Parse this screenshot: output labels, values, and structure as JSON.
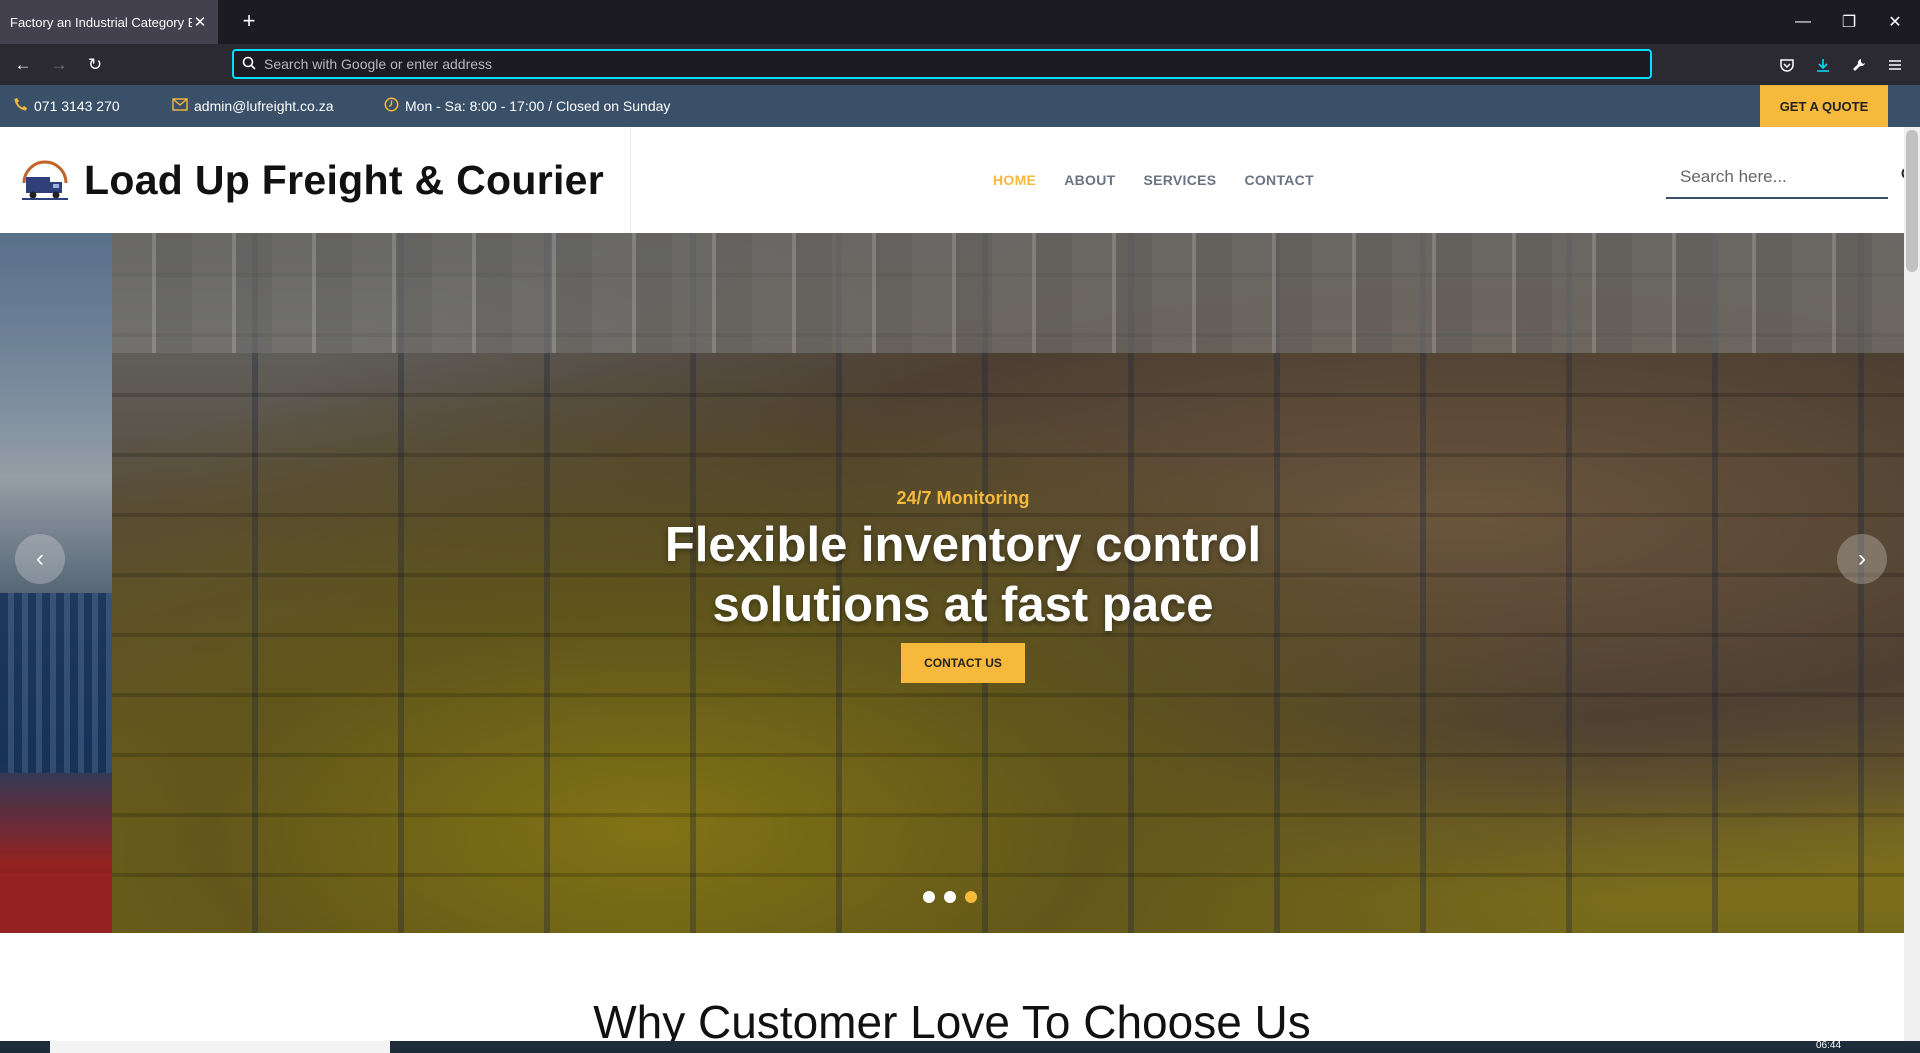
{
  "browser": {
    "tab_title": "Factory an Industrial Category Bootst",
    "url_placeholder": "Search with Google or enter address"
  },
  "topbar": {
    "phone": "071 3143 270",
    "email": "admin@lufreight.co.za",
    "hours": "Mon - Sa: 8:00 - 17:00 / Closed on Sunday",
    "quote_label": "GET A QUOTE"
  },
  "header": {
    "brand_name": "Load Up Freight & Courier",
    "menu": [
      "HOME",
      "ABOUT",
      "SERVICES",
      "CONTACT"
    ],
    "search_placeholder": "Search here..."
  },
  "hero": {
    "kicker": "24/7 Monitoring",
    "headline_line1": "Flexible inventory control",
    "headline_line2": "solutions at fast pace",
    "button_label": "CONTACT US",
    "slide_count": 3,
    "active_slide": 3
  },
  "section": {
    "title": "Why Customer Love To Choose Us"
  },
  "taskbar": {
    "clock": "06:44"
  },
  "colors": {
    "accent": "#f6b93b",
    "topbar": "#3a5068",
    "chrome_dark": "#1c1b22",
    "url_focus": "#00ddff"
  }
}
